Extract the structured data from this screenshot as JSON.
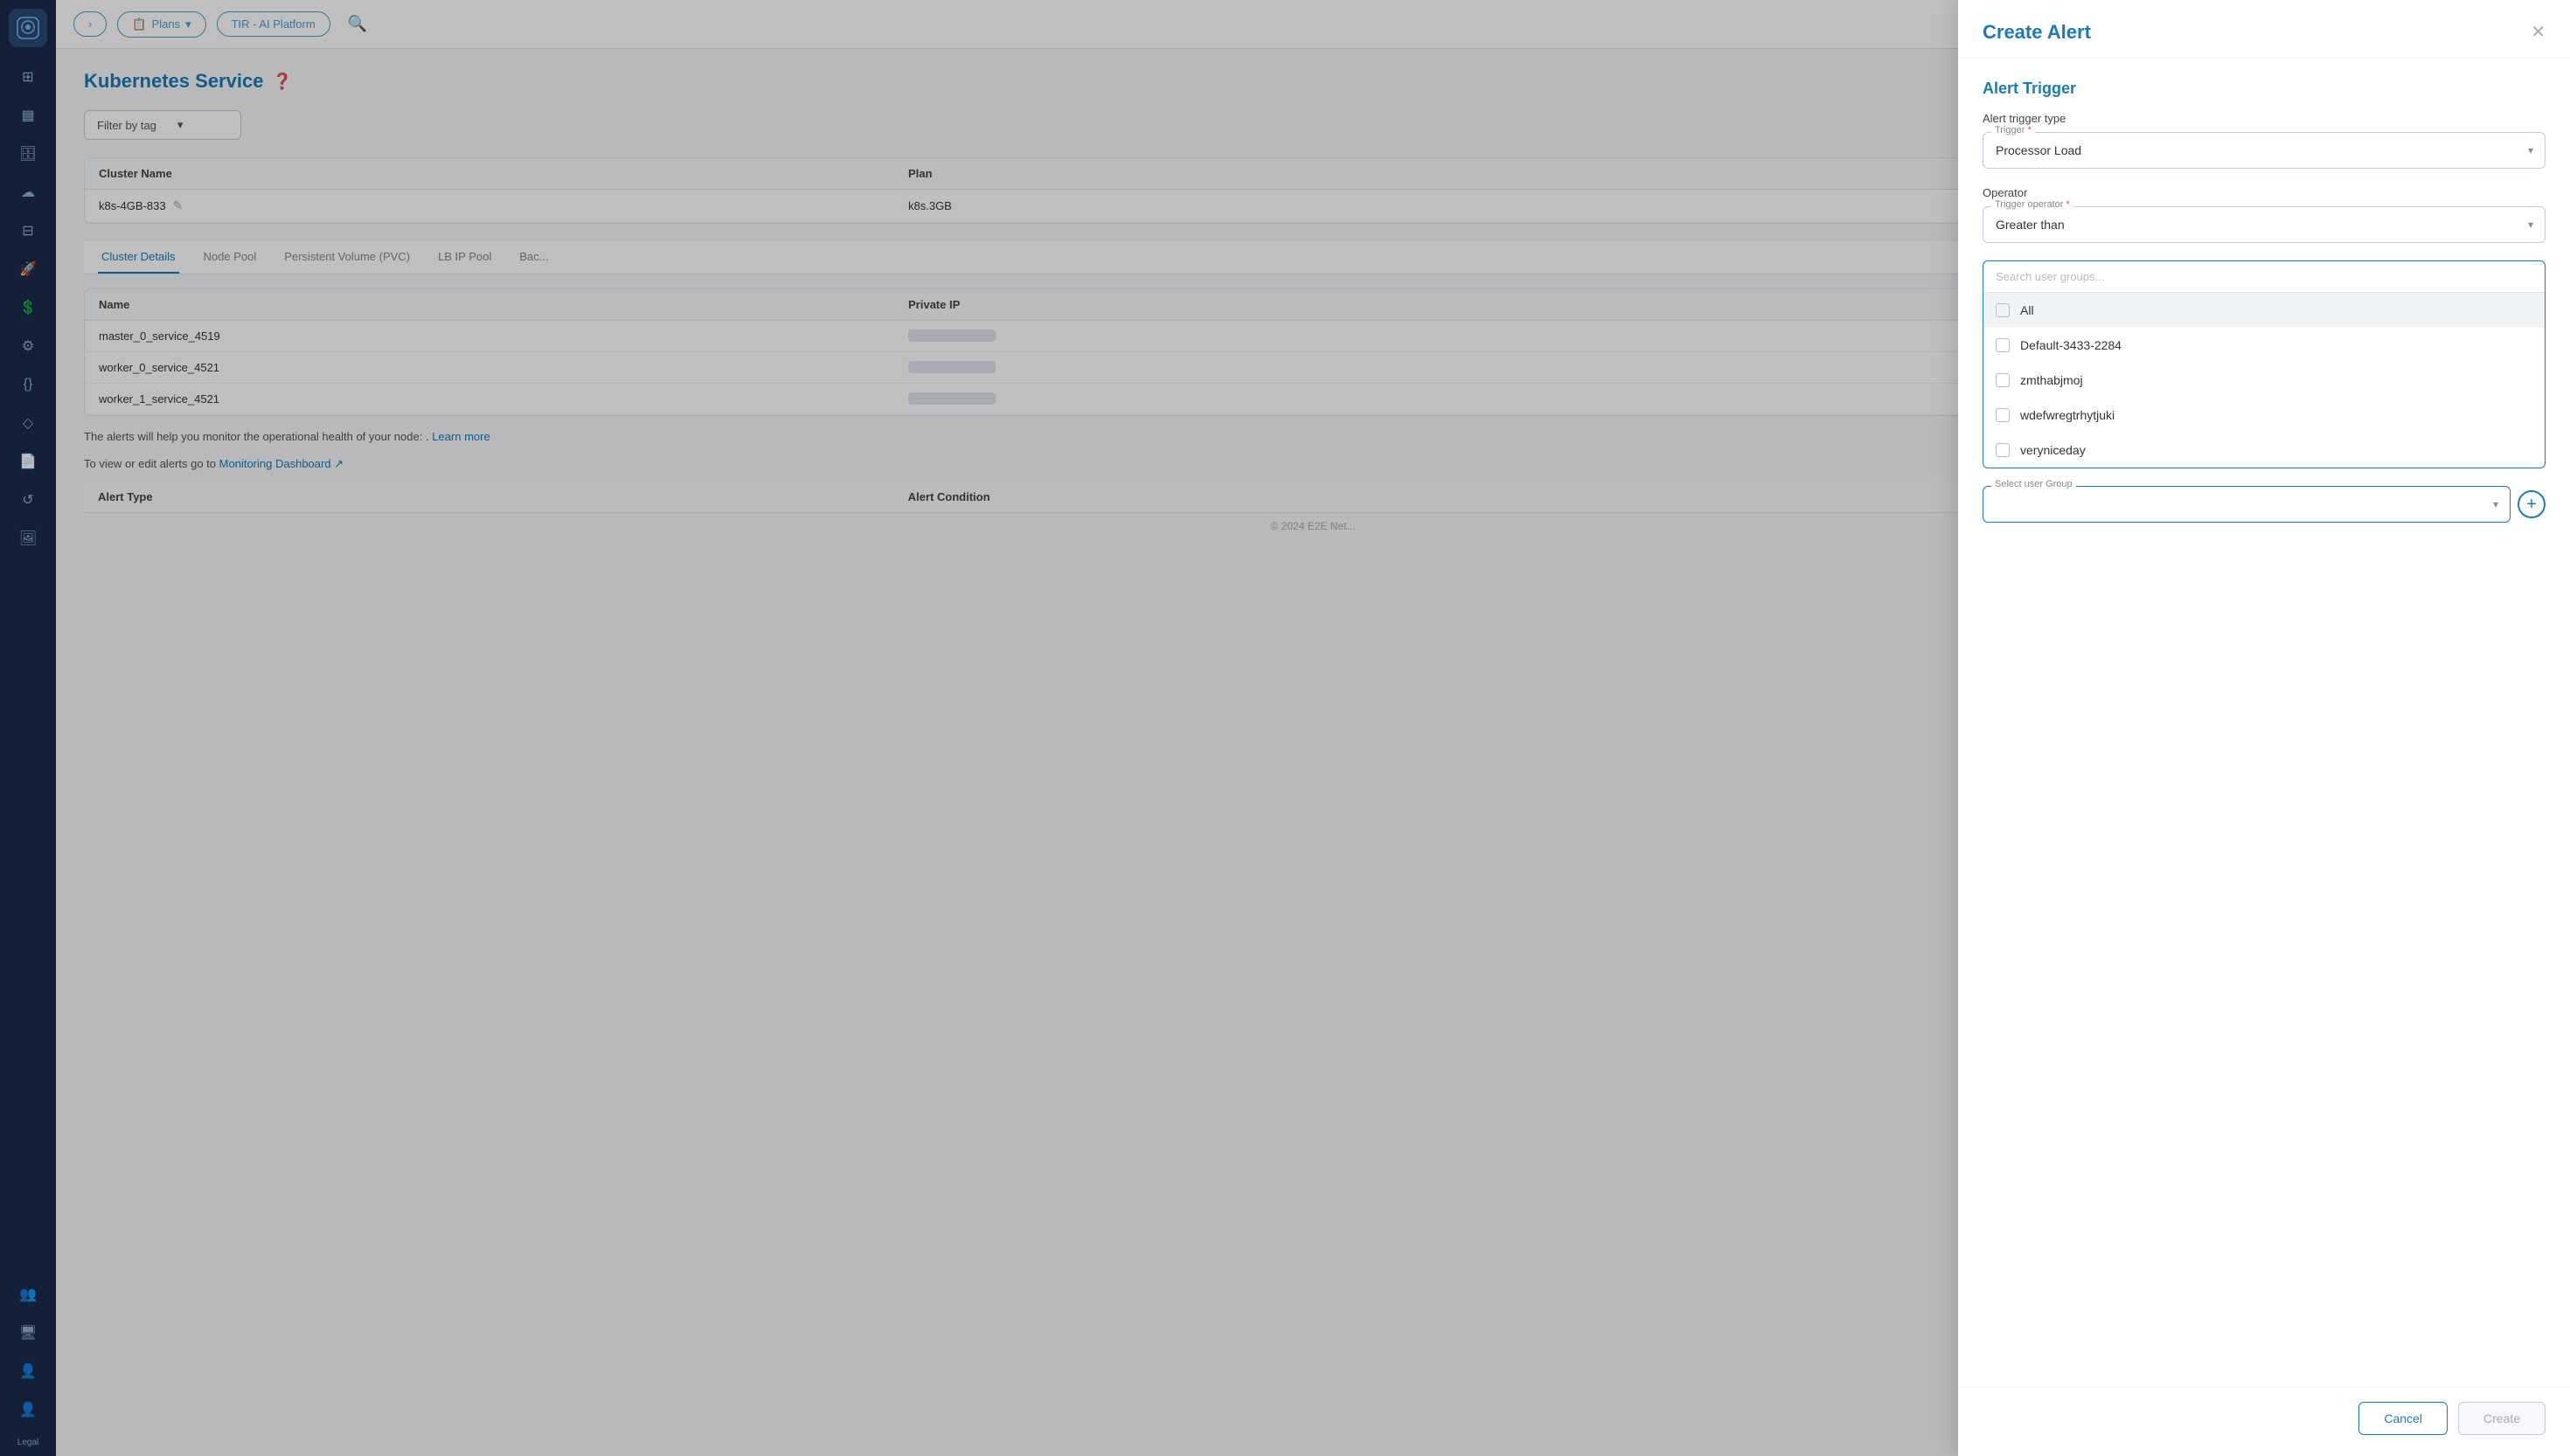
{
  "app": {
    "logo_icon": "☁",
    "platform_label": "TIR - AI Platform"
  },
  "topnav": {
    "plans_label": "Plans",
    "search_icon": "🔍",
    "folder_icon": "📁"
  },
  "sidebar": {
    "items": [
      {
        "id": "grid",
        "icon": "⊞"
      },
      {
        "id": "table",
        "icon": "▦"
      },
      {
        "id": "database",
        "icon": "🗄"
      },
      {
        "id": "cloud",
        "icon": "☁"
      },
      {
        "id": "grid2",
        "icon": "⊟"
      },
      {
        "id": "rocket",
        "icon": "🚀"
      },
      {
        "id": "dollar",
        "icon": "💲"
      },
      {
        "id": "gear",
        "icon": "⚙"
      },
      {
        "id": "code",
        "icon": "{}"
      },
      {
        "id": "branch",
        "icon": "◇"
      },
      {
        "id": "file",
        "icon": "📄"
      },
      {
        "id": "refresh",
        "icon": "↺"
      },
      {
        "id": "image",
        "icon": "🖼"
      },
      {
        "id": "group",
        "icon": "👥"
      },
      {
        "id": "monitor",
        "icon": "🖥"
      },
      {
        "id": "user-add",
        "icon": "👤+"
      },
      {
        "id": "user",
        "icon": "👤"
      }
    ],
    "legal": "Legal"
  },
  "page": {
    "title": "Kubernetes Service",
    "help_icon": "?",
    "filter_label": "Filter by tag",
    "table": {
      "headers": [
        "Cluster Name",
        "Plan",
        ""
      ],
      "rows": [
        {
          "cluster_name": "k8s-4GB-833",
          "plan": "k8s.3GB"
        }
      ]
    },
    "tabs": [
      "Cluster Details",
      "Node Pool",
      "Persistent Volume (PVC)",
      "LB IP Pool",
      "Bac..."
    ],
    "sub_table": {
      "headers": [
        "Name",
        "Private IP",
        ""
      ],
      "rows": [
        {
          "name": "master_0_service_4519",
          "private_ip": ""
        },
        {
          "name": "worker_0_service_4521",
          "private_ip": ""
        },
        {
          "name": "worker_1_service_4521",
          "private_ip": ""
        }
      ]
    },
    "alert_info": "The alerts will help you monitor the operational health of your node: .",
    "learn_more": "Learn more",
    "view_edit_text": "To view or edit alerts go to",
    "monitoring_link": "Monitoring Dashboard ↗",
    "alert_table": {
      "headers": [
        "Alert Type",
        "Alert Condition",
        ""
      ]
    },
    "footer": "© 2024 E2E Net..."
  },
  "dialog": {
    "title": "Create Alert",
    "close_icon": "✕",
    "section_title": "Alert Trigger",
    "alert_trigger_type_label": "Alert trigger type",
    "trigger_field_label": "Trigger",
    "trigger_required": "*",
    "trigger_value": "Processor Load",
    "operator_label": "Operator",
    "trigger_operator_label": "Trigger operator",
    "trigger_operator_required": "*",
    "trigger_operator_value": "Greater than",
    "search_placeholder": "Search user groups...",
    "options": [
      {
        "id": "all",
        "label": "All",
        "checked": false
      },
      {
        "id": "default",
        "label": "Default-3433-2284",
        "checked": false
      },
      {
        "id": "zmthabjmoj",
        "label": "zmthabjmoj",
        "checked": false
      },
      {
        "id": "wdefwregtrhytjuki",
        "label": "wdefwregtrhytjuki",
        "checked": false
      },
      {
        "id": "veryniceday",
        "label": "veryniceday",
        "checked": false
      }
    ],
    "user_group_label": "Select user Group",
    "add_icon": "+",
    "cancel_label": "Cancel",
    "create_label": "Create"
  }
}
